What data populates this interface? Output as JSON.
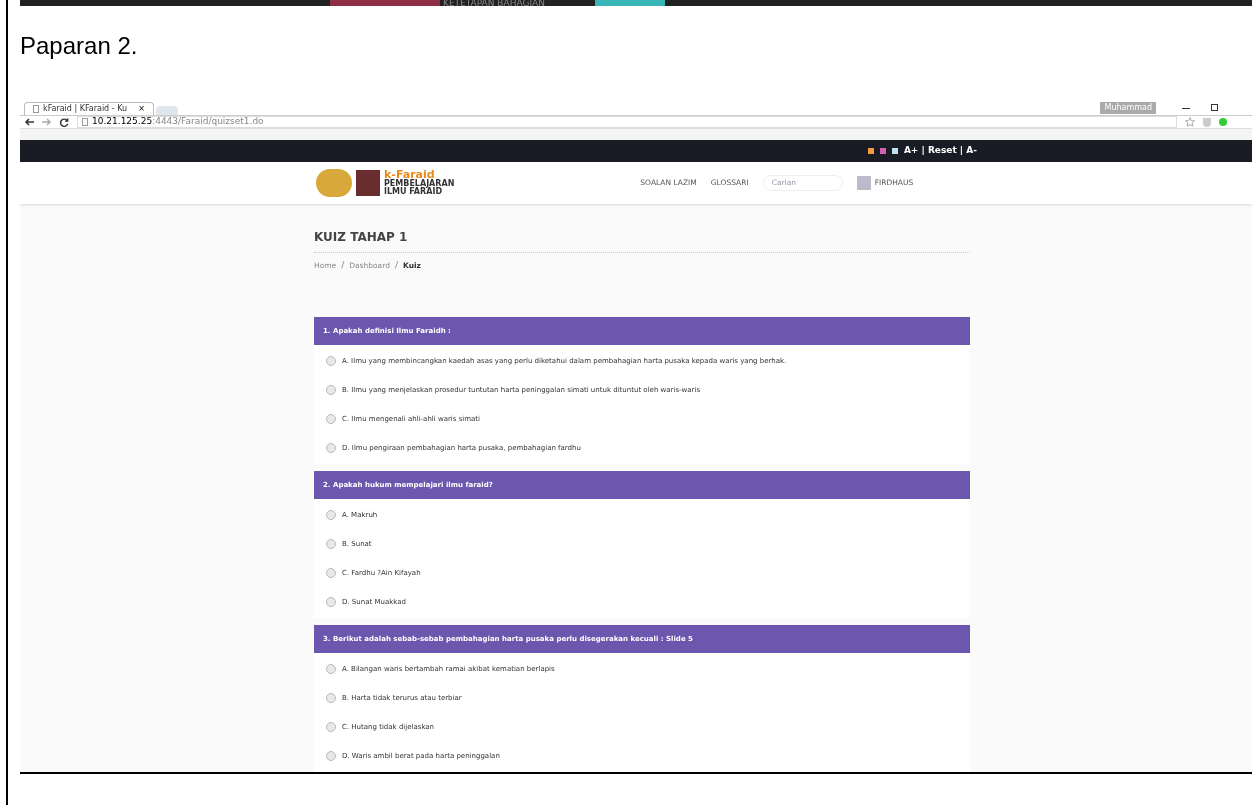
{
  "previous_page_strip": {
    "label": "KETETAPAN BAHAGIAN"
  },
  "document_heading": "Paparan 2.",
  "browser": {
    "tab_title": "kFaraid | KFaraid - Ku",
    "tab_close": "×",
    "profile_name": "Muhammad",
    "url_host": "10.21.125.25",
    "url_path": ":4443/Faraid/quizset1.do"
  },
  "site": {
    "top_bar": {
      "color_swatches": [
        {
          "color": "#f39c3c"
        },
        {
          "color": "#d45fb5"
        },
        {
          "color": "#bfe3f0"
        }
      ],
      "font_controls": "A+ | Reset | A-"
    },
    "logo": {
      "title": "k-Faraid",
      "subtitle_1": "PEMBELAJARAN",
      "subtitle_2": "ILMU FARAID"
    },
    "nav": [
      {
        "label": "SOALAN LAZIM"
      },
      {
        "label": "GLOSSARI"
      }
    ],
    "search": {
      "placeholder": "Carian"
    },
    "user": "FIRDHAUS"
  },
  "page_title": "KUIZ TAHAP 1",
  "breadcrumb_separator": "/",
  "breadcrumb": [
    {
      "label": "Home",
      "current": false
    },
    {
      "label": "Dashboard",
      "current": false
    },
    {
      "label": "Kuiz",
      "current": true
    }
  ],
  "questions": [
    {
      "title": "1. Apakah definisi Ilmu Faraidh :",
      "options": [
        {
          "label": "A. Ilmu yang membincangkan kaedah asas yang perlu diketahui dalam pembahagian harta pusaka kepada waris yang berhak.",
          "selected": false
        },
        {
          "label": "B. Ilmu yang menjelaskan prosedur tuntutan harta peninggalan simati untuk dituntut oleh waris-waris",
          "selected": false
        },
        {
          "label": "C. Ilmu mengenali ahli-ahli waris simati",
          "selected": false
        },
        {
          "label": "D. Ilmu pengiraan pembahagian harta pusaka, pembahagian fardhu",
          "selected": false
        }
      ]
    },
    {
      "title": "2. Apakah hukum mempelajari ilmu faraid?",
      "options": [
        {
          "label": "A. Makruh",
          "selected": false
        },
        {
          "label": "B. Sunat",
          "selected": false
        },
        {
          "label": "C. Fardhu ?Ain Kifayah",
          "selected": false
        },
        {
          "label": "D. Sunat Muakkad",
          "selected": false
        }
      ]
    },
    {
      "title": "3. Berikut adalah sebab-sebab pembahagian harta pusaka perlu disegerakan kecuali : Slide 5",
      "options": [
        {
          "label": "A. Bilangan waris bertambah ramai akibat kematian berlapis",
          "selected": false
        },
        {
          "label": "B. Harta tidak terurus atau terbiar",
          "selected": false
        },
        {
          "label": "C. Hutang tidak dijelaskan",
          "selected": false
        },
        {
          "label": "D. Waris ambil berat pada harta peninggalan",
          "selected": false
        }
      ]
    }
  ]
}
